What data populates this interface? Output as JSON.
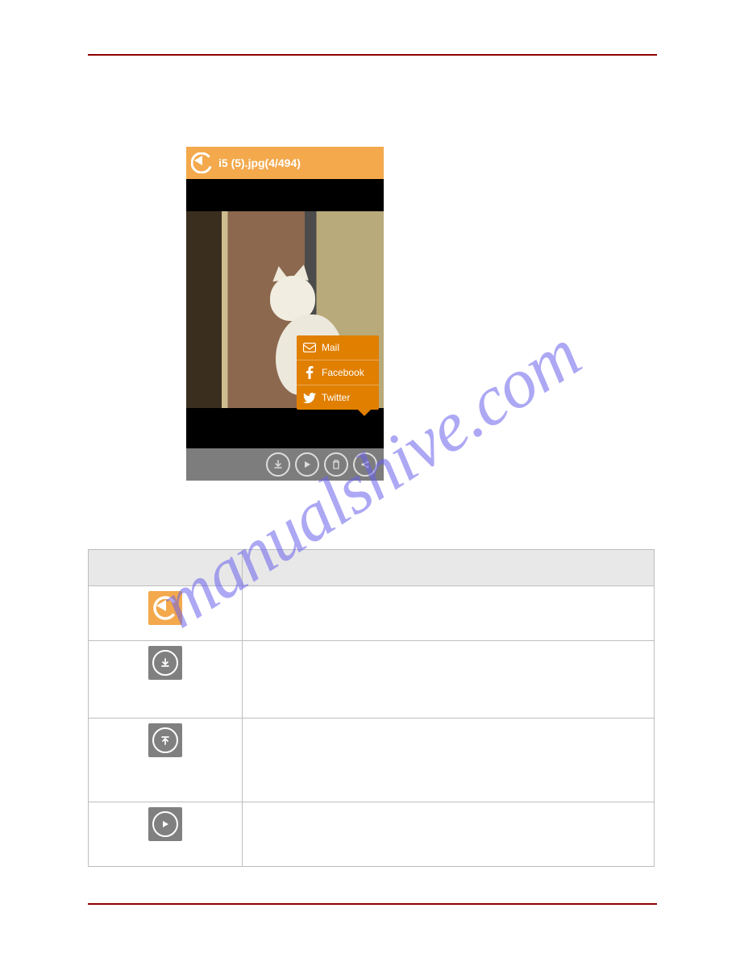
{
  "phone": {
    "title": "i5 (5).jpg(4/494)"
  },
  "share_menu": {
    "mail": "Mail",
    "facebook": "Facebook",
    "twitter": "Twitter"
  },
  "watermark": "manualshive.com"
}
